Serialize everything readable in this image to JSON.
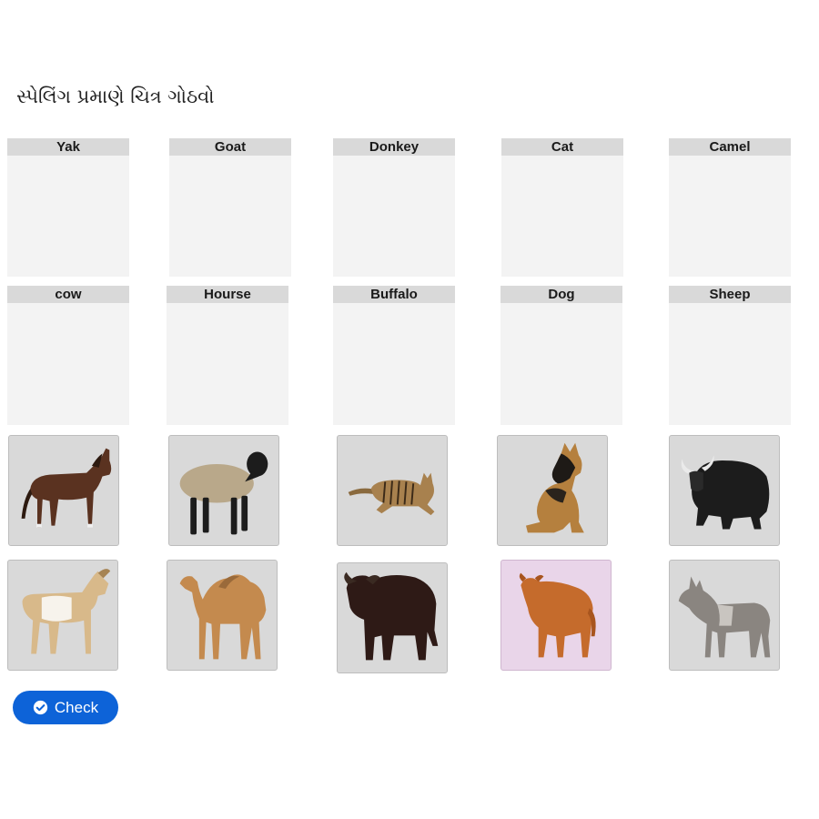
{
  "instruction": "સ્પેલિંગ પ્રમાણે ચિત્ર ગોઠવો",
  "drop_zones_row1": [
    {
      "label": "Yak"
    },
    {
      "label": "Goat"
    },
    {
      "label": "Donkey"
    },
    {
      "label": "Cat"
    },
    {
      "label": "Camel"
    }
  ],
  "drop_zones_row2": [
    {
      "label": "cow"
    },
    {
      "label": "Hourse"
    },
    {
      "label": "Buffalo"
    },
    {
      "label": "Dog"
    },
    {
      "label": "Sheep"
    }
  ],
  "animal_cards": [
    {
      "animal": "horse-icon"
    },
    {
      "animal": "sheep-icon"
    },
    {
      "animal": "cat-icon"
    },
    {
      "animal": "dog-icon"
    },
    {
      "animal": "yak-icon"
    },
    {
      "animal": "goat-icon"
    },
    {
      "animal": "camel-icon"
    },
    {
      "animal": "buffalo-icon"
    },
    {
      "animal": "cow-icon",
      "selected": true
    },
    {
      "animal": "donkey-icon"
    }
  ],
  "check_button": {
    "label": "Check",
    "icon": "check-circle-icon",
    "color": "#0d63d8"
  },
  "colors": {
    "zone_header": "#d9d9d9",
    "zone_body": "#f3f3f3",
    "card_bg": "#d9d9d9",
    "card_selected_bg": "#e9d5e9"
  }
}
